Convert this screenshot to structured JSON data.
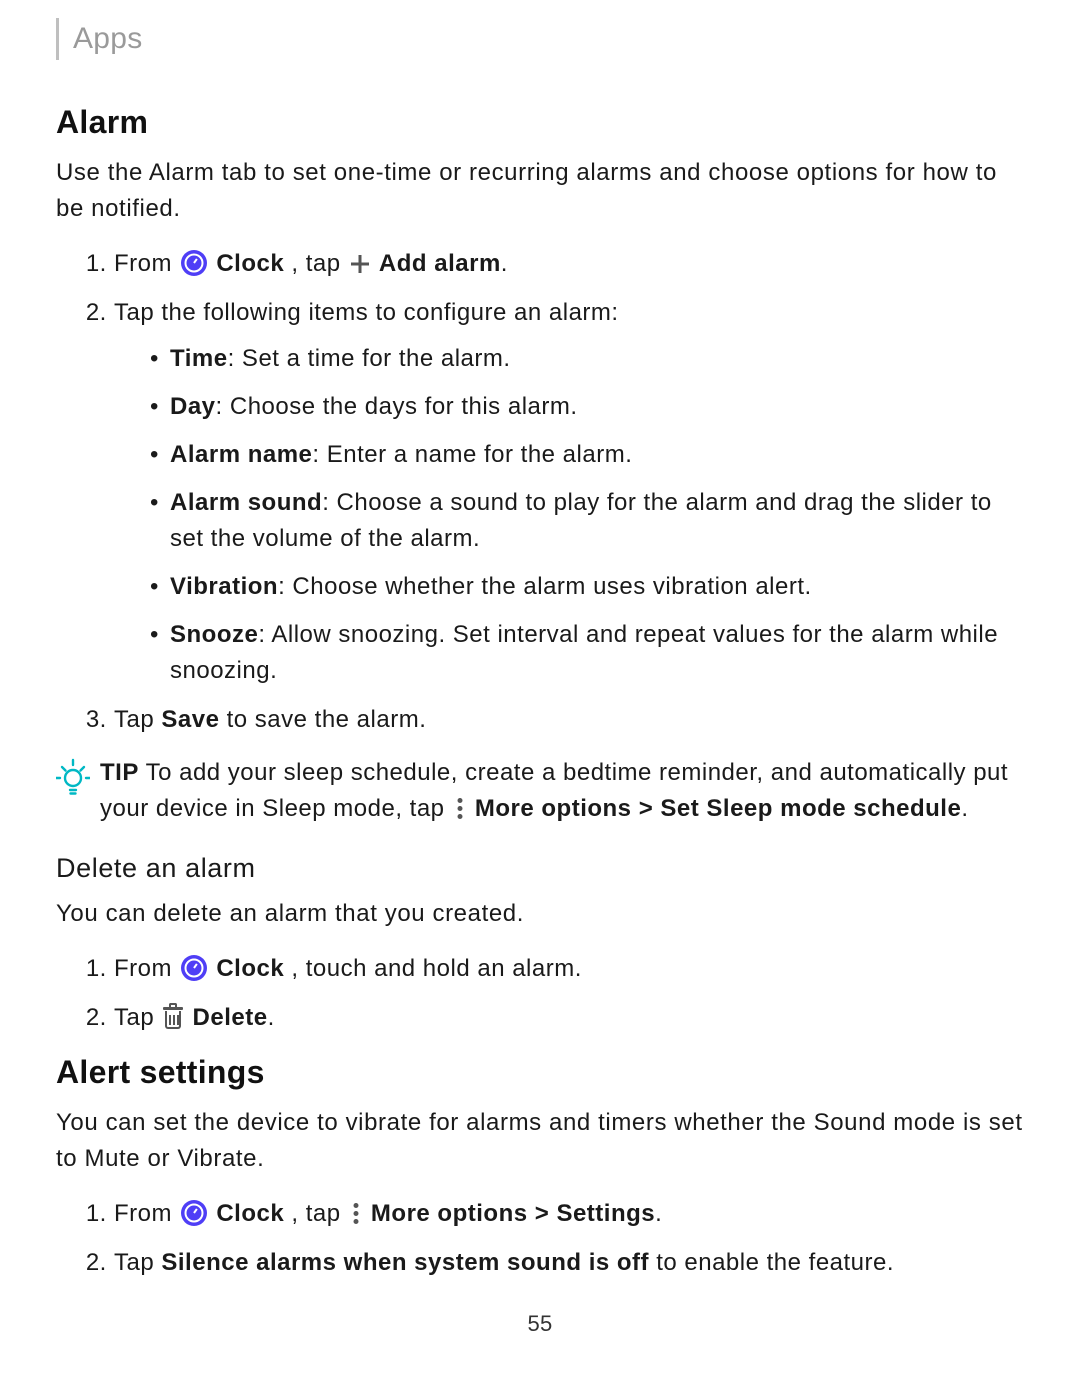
{
  "breadcrumb": "Apps",
  "page_number": "55",
  "alarm": {
    "heading": "Alarm",
    "intro": "Use the Alarm tab to set one-time or recurring alarms and choose options for how to be notified.",
    "step1": {
      "pre": "From ",
      "clock": "Clock",
      "mid": ", tap ",
      "add": "Add alarm",
      "suffix": "."
    },
    "step2_lead": "Tap the following items to configure an alarm:",
    "items": {
      "time": {
        "label": "Time",
        "desc": ": Set a time for the alarm."
      },
      "day": {
        "label": "Day",
        "desc": ": Choose the days for this alarm."
      },
      "name": {
        "label": "Alarm name",
        "desc": ": Enter a name for the alarm."
      },
      "sound": {
        "label": "Alarm sound",
        "desc": ": Choose a sound to play for the alarm and drag the slider to set the volume of the alarm."
      },
      "vib": {
        "label": "Vibration",
        "desc": ": Choose whether the alarm uses vibration alert."
      },
      "snooze": {
        "label": "Snooze",
        "desc": ": Allow snoozing. Set interval and repeat values for the alarm while snoozing."
      }
    },
    "step3": {
      "pre": "Tap ",
      "save": "Save",
      "post": " to save the alarm."
    },
    "tip": {
      "label": "TIP",
      "pre": "  To add your sleep schedule, create a bedtime reminder, and automatically put your device in Sleep mode, tap ",
      "more": "More options",
      "gt": " > ",
      "set": "Set Sleep mode schedule",
      "suffix": "."
    }
  },
  "delete_alarm": {
    "heading": "Delete an alarm",
    "intro": "You can delete an alarm that you created.",
    "step1": {
      "pre": "From ",
      "clock": "Clock",
      "post": ", touch and hold an alarm."
    },
    "step2": {
      "pre": "Tap ",
      "delete": "Delete",
      "suffix": "."
    }
  },
  "alert": {
    "heading": "Alert settings",
    "intro": "You can set the device to vibrate for alarms and timers whether the Sound mode is set to Mute or Vibrate.",
    "step1": {
      "pre": "From ",
      "clock": "Clock",
      "mid": ", tap ",
      "more": "More options",
      "gt": " > ",
      "settings": "Settings",
      "suffix": "."
    },
    "step2": {
      "pre": "Tap ",
      "toggle": "Silence alarms when system sound is off",
      "post": " to enable the feature."
    }
  }
}
